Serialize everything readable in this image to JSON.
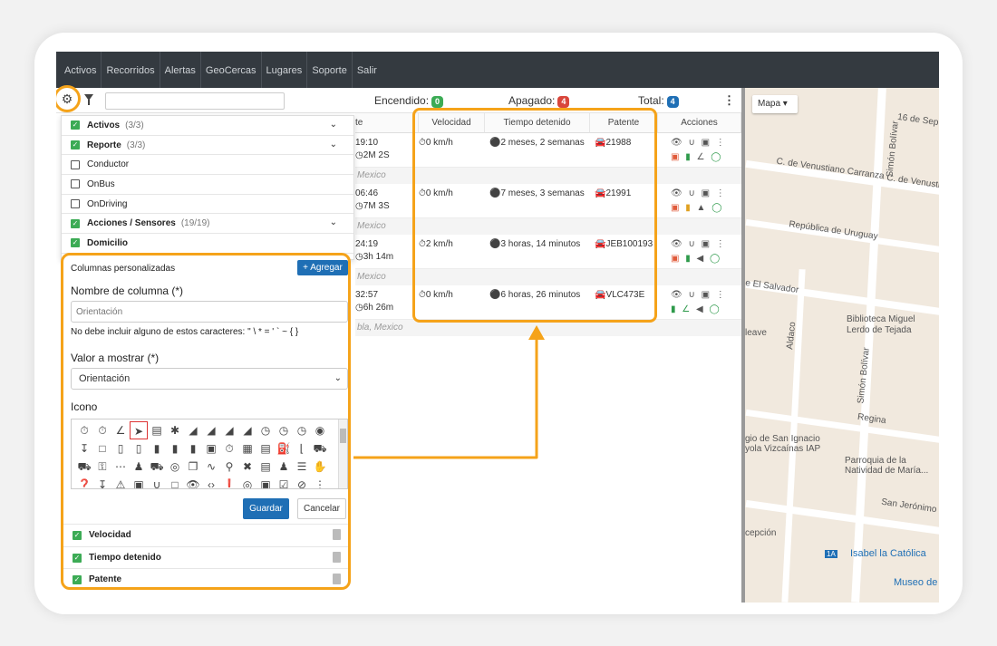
{
  "nav": {
    "items": [
      "Activos",
      "Recorridos",
      "Alertas",
      "GeoCercas",
      "Lugares",
      "Soporte",
      "Salir"
    ]
  },
  "toolbar": {
    "encendido_label": "Encendido:",
    "encendido_count": "0",
    "apagado_label": "Apagado:",
    "apagado_count": "4",
    "total_label": "Total:",
    "total_count": "4",
    "search_placeholder": ""
  },
  "grid": {
    "headers": {
      "partial": "te",
      "velocidad": "Velocidad",
      "tiempo": "Tiempo detenido",
      "patente": "Patente",
      "acciones": "Acciones"
    },
    "rows": [
      {
        "time": "19:10",
        "dur": "2M 2S",
        "speed": "0 km/h",
        "stopped": "2 meses, 2 semanas",
        "plate": "21988",
        "loc": "Mexico"
      },
      {
        "time": "06:46",
        "dur": "7M 3S",
        "speed": "0 km/h",
        "stopped": "7 meses, 3 semanas",
        "plate": "21991",
        "loc": "Mexico"
      },
      {
        "time": "24:19",
        "dur": "3h 14m",
        "speed": "2 km/h",
        "stopped": "3 horas, 14 minutos",
        "plate": "JEB100193",
        "loc": "Mexico"
      },
      {
        "time": "32:57",
        "dur": "6h 26m",
        "speed": "0 km/h",
        "stopped": "6 horas, 26 minutos",
        "plate": "VLC473E",
        "loc": "bla, Mexico"
      }
    ]
  },
  "leftpanel": {
    "items": [
      {
        "label": "Activos",
        "count": "(3/3)",
        "checked": true
      },
      {
        "label": "Reporte",
        "count": "(3/3)",
        "checked": true
      },
      {
        "label": "Conductor",
        "count": "",
        "checked": false
      },
      {
        "label": "OnBus",
        "count": "",
        "checked": false
      },
      {
        "label": "OnDriving",
        "count": "",
        "checked": false
      },
      {
        "label": "Acciones / Sensores",
        "count": "(19/19)",
        "checked": true
      },
      {
        "label": "Domicilio",
        "count": "",
        "checked": true
      }
    ]
  },
  "custom": {
    "title": "Columnas personalizadas",
    "add_label": "+ Agregar",
    "name_label": "Nombre de columna (*)",
    "name_placeholder": "Orientación",
    "help": "No debe incluir alguno de estos caracteres: \" \\ * = ' ` ~ { }",
    "value_label": "Valor a mostrar (*)",
    "value_selected": "Orientación",
    "icon_label": "Icono",
    "save_label": "Guardar",
    "cancel_label": "Cancelar",
    "enabled": [
      "Velocidad",
      "Tiempo detenido",
      "Patente"
    ]
  },
  "map": {
    "type_label": "Mapa",
    "labels": [
      "16 de Sep",
      "Simón Bolívar",
      "C. de Venustiano Carranza",
      "C. de Venusti",
      "República de Uruguay",
      "e El Salvador",
      "Biblioteca Miguel",
      "Lerdo de Tejada",
      "leave",
      "Aldaco",
      "Simón Bolívar",
      "Regina",
      "gio de San Ignacio",
      "yola Vizcaínas IAP",
      "Parroquia de la",
      "Natividad de María...",
      "San Jerónimo",
      "cepción",
      "Isabel la Católica",
      "1A",
      "Museo de"
    ]
  },
  "colors": {
    "accent": "#f5a31a",
    "primary": "#1f6fb5",
    "green": "#3cab55",
    "red": "#d9463b",
    "nav": "#343a40"
  }
}
